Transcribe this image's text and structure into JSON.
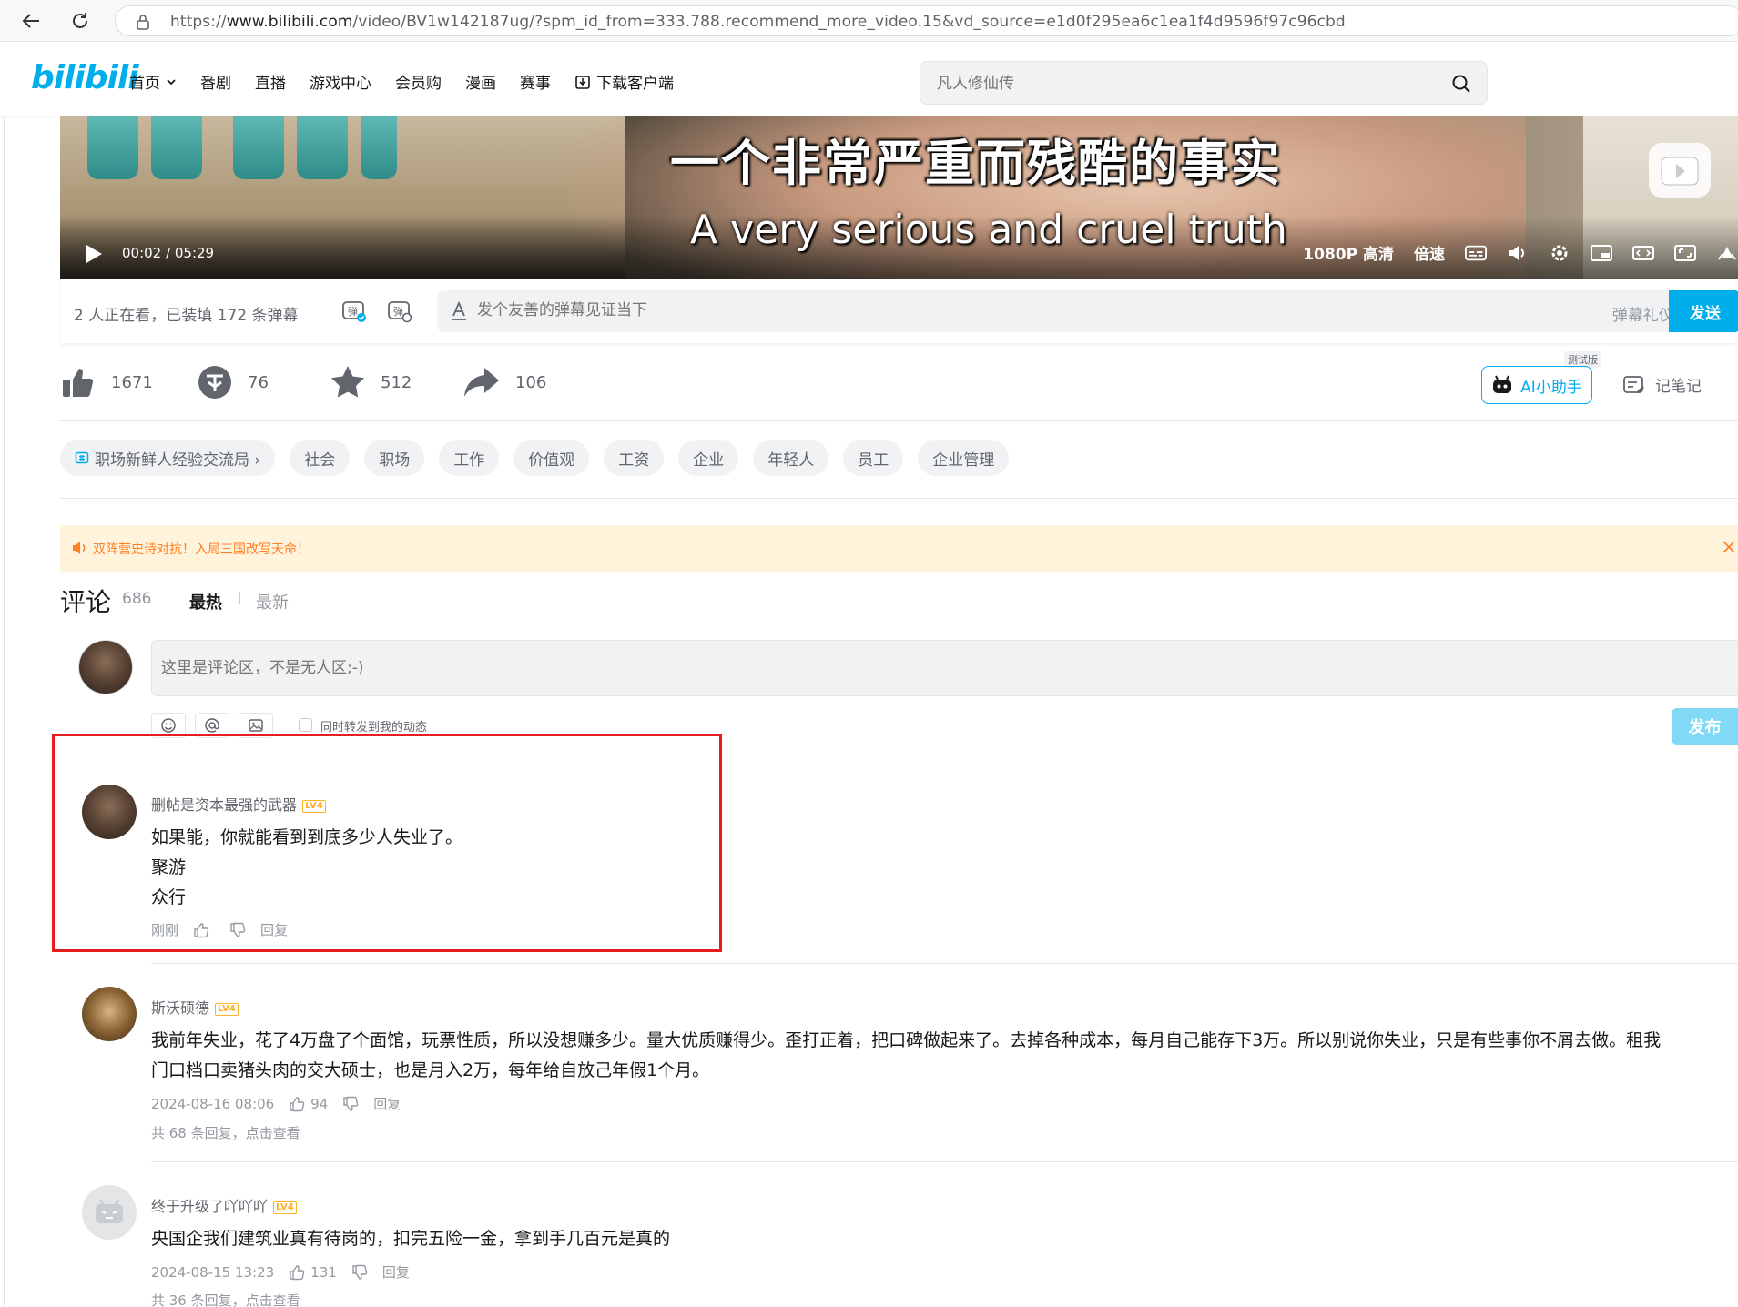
{
  "browser": {
    "url_prefix": "https://",
    "url_host": "www.bilibili.com",
    "url_path": "/video/BV1w142187ug/?spm_id_from=333.788.recommend_more_video.15&vd_source=e1d0f295ea6c1ea1f4d9596f97c96cbd"
  },
  "header": {
    "logo": "bilibili",
    "nav": [
      "首页",
      "番剧",
      "直播",
      "游戏中心",
      "会员购",
      "漫画",
      "赛事",
      "下载客户端"
    ],
    "search_placeholder": "凡人修仙传"
  },
  "player": {
    "subtitle_cn": "一个非常严重而残酷的事实",
    "subtitle_en": "A very serious and cruel truth",
    "time_current": "00:02",
    "time_sep": "/",
    "time_total": "05:29",
    "quality": "1080P 高清",
    "speed": "倍速"
  },
  "danmaku": {
    "watch_info": "2 人正在看，已装填 172 条弹幕",
    "input_placeholder": "发个友善的弹幕见证当下",
    "etiquette": "弹幕礼仪 ›",
    "send": "发送"
  },
  "actions": {
    "like": "1671",
    "coin": "76",
    "favorite": "512",
    "share": "106",
    "ai_assistant": "AI小助手",
    "test_badge": "测试版",
    "notes": "记笔记"
  },
  "tags": [
    "职场新鲜人经验交流局 ›",
    "社会",
    "职场",
    "工作",
    "价值观",
    "工资",
    "企业",
    "年轻人",
    "员工",
    "企业管理"
  ],
  "notice": {
    "text": "双阵营史诗对抗！入局三国改写天命！"
  },
  "comments_header": {
    "title": "评论",
    "count": "686",
    "sort_hot": "最热",
    "sort_new": "最新"
  },
  "composer": {
    "placeholder": "这里是评论区，不是无人区;-)",
    "forward_label": "同时转发到我的动态",
    "publish": "发布"
  },
  "comments": [
    {
      "name": "删帖是资本最强的武器",
      "level": "LV4",
      "lines": [
        "如果能，你就能看到到底多少人失业了。",
        "聚游",
        "众行"
      ],
      "time": "刚刚",
      "likes": "",
      "reply": "回复",
      "replies": ""
    },
    {
      "name": "斯沃硕德",
      "level": "LV4",
      "lines": [
        "我前年失业，花了4万盘了个面馆，玩票性质，所以没想赚多少。量大优质赚得少。歪打正着，把口碑做起来了。去掉各种成本，每月自己能存下3万。所以别说你失业，只是有些事你不屑去做。租我",
        "门口档口卖猪头肉的交大硕士，也是月入2万，每年给自放己年假1个月。"
      ],
      "time": "2024-08-16 08:06",
      "likes": "94",
      "reply": "回复",
      "replies": "共 68 条回复，点击查看"
    },
    {
      "name": "终于升级了吖吖吖",
      "level": "LV4",
      "lines": [
        "央国企我们建筑业真有待岗的，扣完五险一金，拿到手几百元是真的"
      ],
      "time": "2024-08-15 13:23",
      "likes": "131",
      "reply": "回复",
      "replies": "共 36 条回复，点击查看"
    }
  ]
}
